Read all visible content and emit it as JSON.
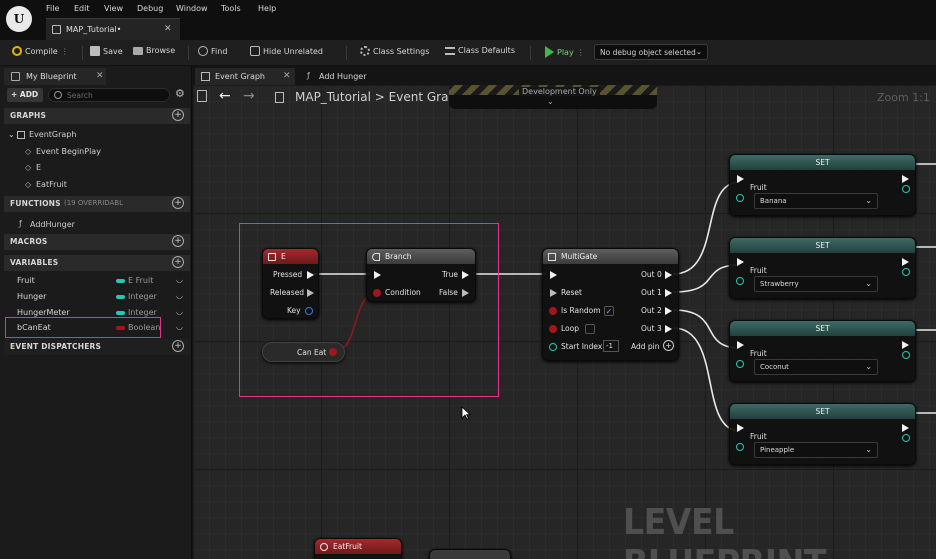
{
  "menu": [
    "File",
    "Edit",
    "View",
    "Debug",
    "Window",
    "Tools",
    "Help"
  ],
  "document_tab": "MAP_Tutorial•",
  "toolbar": {
    "compile": "Compile",
    "save": "Save",
    "browse": "Browse",
    "find": "Find",
    "hide_unrelated": "Hide Unrelated",
    "class_settings": "Class Settings",
    "class_defaults": "Class Defaults",
    "play": "Play",
    "debug_object": "No debug object selected"
  },
  "left_panel": {
    "tab": "My Blueprint",
    "add": "+ ADD",
    "search_placeholder": "Search",
    "sections": {
      "graphs": "GRAPHS",
      "functions": "FUNCTIONS",
      "functions_note": "(19 OVERRIDABL",
      "macros": "MACROS",
      "variables": "VARIABLES",
      "dispatchers": "EVENT DISPATCHERS"
    },
    "graphs": [
      "EventGraph",
      "Event BeginPlay",
      "E",
      "EatFruit"
    ],
    "functions": [
      "AddHunger"
    ],
    "variables": [
      {
        "name": "Fruit",
        "type": "E Fruit",
        "color": "#25c8b4"
      },
      {
        "name": "Hunger",
        "type": "Integer",
        "color": "#25c8b4"
      },
      {
        "name": "HungerMeter",
        "type": "Integer",
        "color": "#25c8b4"
      },
      {
        "name": "bCanEat",
        "type": "Boolean",
        "color": "#a0161c"
      }
    ]
  },
  "graph_tabs": [
    "Event Graph",
    "Add Hunger"
  ],
  "breadcrumb": {
    "root": "MAP_Tutorial",
    "separator": ">",
    "page": "Event Graph"
  },
  "dev_banner": "Development Only",
  "zoom": "Zoom 1:1",
  "watermark": "LEVEL BLUEPRINT",
  "nodes": {
    "e_event": {
      "title": "E",
      "pins": [
        "Pressed",
        "Released",
        "Key"
      ]
    },
    "can_eat": {
      "title": "Can Eat"
    },
    "branch": {
      "title": "Branch",
      "condition": "Condition",
      "true": "True",
      "false": "False"
    },
    "multigate": {
      "title": "MultiGate",
      "reset": "Reset",
      "is_random": "Is Random",
      "loop": "Loop",
      "start_index": "Start Index",
      "start_index_value": "-1",
      "outs": [
        "Out 0",
        "Out 1",
        "Out 2",
        "Out 3"
      ],
      "add_pin": "Add pin"
    },
    "sets": [
      {
        "title": "SET",
        "pin": "Fruit",
        "value": "Banana"
      },
      {
        "title": "SET",
        "pin": "Fruit",
        "value": "Strawberry"
      },
      {
        "title": "SET",
        "pin": "Fruit",
        "value": "Coconut"
      },
      {
        "title": "SET",
        "pin": "Fruit",
        "value": "Pineapple"
      }
    ],
    "eat_fruit": {
      "title": "EatFruit"
    }
  },
  "colors": {
    "accent_highlight": "#e0338a",
    "event_red": "#8e1c1f",
    "set_teal": "#3f6a66",
    "exec_white": "#f2f2f2",
    "bool_red": "#a0161c",
    "enum_teal": "#25c8b4",
    "play_green": "#41b649"
  }
}
